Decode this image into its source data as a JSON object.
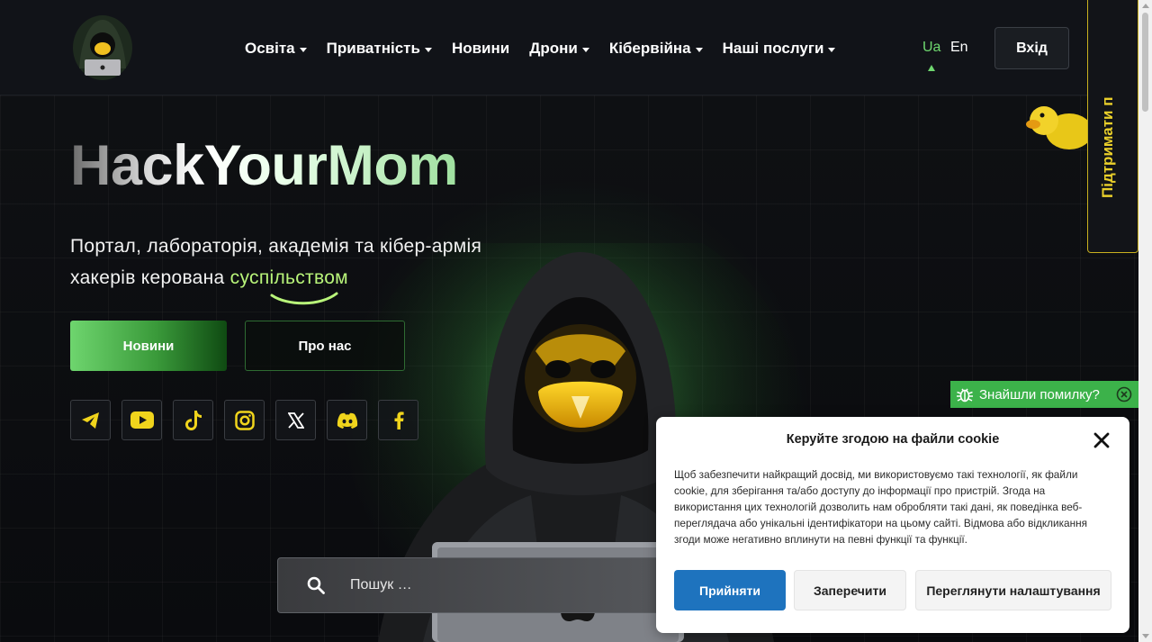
{
  "header": {
    "nav": [
      {
        "label": "Освіта",
        "dropdown": true
      },
      {
        "label": "Приватність",
        "dropdown": true
      },
      {
        "label": "Новини",
        "dropdown": false
      },
      {
        "label": "Дрони",
        "dropdown": true
      },
      {
        "label": "Кібервійна",
        "dropdown": true
      },
      {
        "label": "Наші послуги",
        "dropdown": true
      }
    ],
    "lang_active": "Ua",
    "lang_other": "En",
    "login_label": "Вхід",
    "accent_color": "#6fd86f"
  },
  "support_tab": {
    "label": "Підтримати п"
  },
  "hero": {
    "title": "HackYourMom",
    "subtitle_line1": "Портал, лабораторія, академія та кібер-армія",
    "subtitle_line2_prefix": "хакерів керована ",
    "subtitle_highlight": "суспільством",
    "news_button": "Новини",
    "about_button": "Про нас"
  },
  "socials": [
    "telegram-icon",
    "youtube-icon",
    "tiktok-icon",
    "instagram-icon",
    "x-icon",
    "discord-icon",
    "facebook-icon"
  ],
  "search": {
    "placeholder": "Пошук …"
  },
  "bug_report": {
    "label": "Знайшли помилку?"
  },
  "cookie": {
    "title": "Керуйте згодою на файли cookie",
    "body": "Щоб забезпечити найкращий досвід, ми використовуємо такі технології, як файли cookie, для зберігання та/або доступу до інформації про пристрій. Згода на використання цих технологій дозволить нам обробляти такі дані, як поведінка веб-переглядача або унікальні ідентифікатори на цьому сайті. Відмова або відкликання згоди може негативно вплинути на певні функції та функції.",
    "accept": "Прийняти",
    "deny": "Заперечити",
    "preferences": "Переглянути налаштування",
    "accept_color": "#1e73be"
  }
}
